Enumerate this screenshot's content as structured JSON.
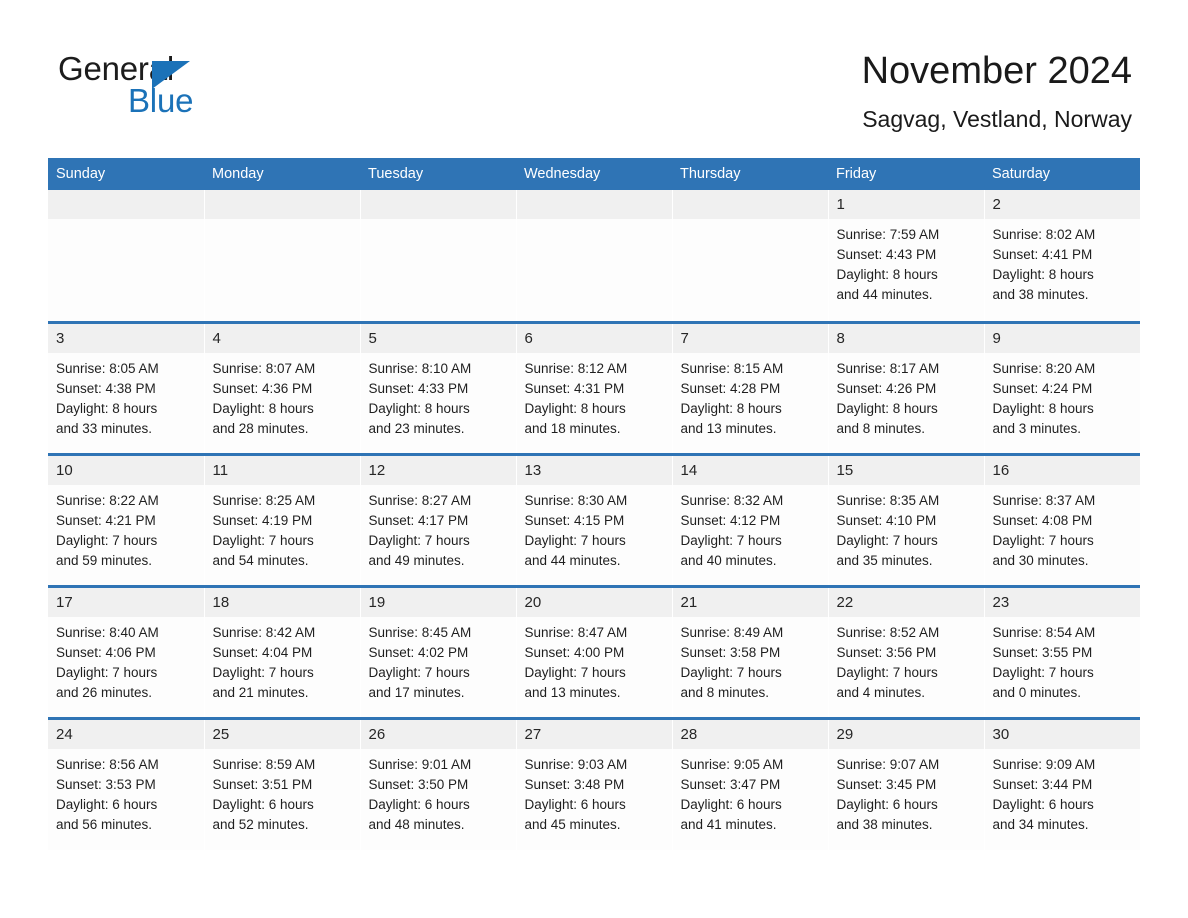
{
  "logo": {
    "word1": "General",
    "word2": "Blue",
    "triangle_color": "#1b72b8"
  },
  "header": {
    "title": "November 2024",
    "subtitle": "Sagvag, Vestland, Norway"
  },
  "theme": {
    "header_blue": "#2f74b5",
    "daynum_band": "#f0f0f0",
    "cell_background": "#fdfdfd",
    "text": "#1a1a1a"
  },
  "weekday_headers": [
    "Sunday",
    "Monday",
    "Tuesday",
    "Wednesday",
    "Thursday",
    "Friday",
    "Saturday"
  ],
  "labels": {
    "sunrise_prefix": "Sunrise:",
    "sunset_prefix": "Sunset:",
    "daylight_prefix": "Daylight:"
  },
  "weeks": [
    [
      {
        "day": "",
        "empty": true,
        "line1": "",
        "line2": "",
        "line3": "",
        "line4": ""
      },
      {
        "day": "",
        "empty": true,
        "line1": "",
        "line2": "",
        "line3": "",
        "line4": ""
      },
      {
        "day": "",
        "empty": true,
        "line1": "",
        "line2": "",
        "line3": "",
        "line4": ""
      },
      {
        "day": "",
        "empty": true,
        "line1": "",
        "line2": "",
        "line3": "",
        "line4": ""
      },
      {
        "day": "",
        "empty": true,
        "line1": "",
        "line2": "",
        "line3": "",
        "line4": ""
      },
      {
        "day": "1",
        "empty": false,
        "line1": "Sunrise: 7:59 AM",
        "line2": "Sunset: 4:43 PM",
        "line3": "Daylight: 8 hours",
        "line4": "and 44 minutes."
      },
      {
        "day": "2",
        "empty": false,
        "line1": "Sunrise: 8:02 AM",
        "line2": "Sunset: 4:41 PM",
        "line3": "Daylight: 8 hours",
        "line4": "and 38 minutes."
      }
    ],
    [
      {
        "day": "3",
        "empty": false,
        "line1": "Sunrise: 8:05 AM",
        "line2": "Sunset: 4:38 PM",
        "line3": "Daylight: 8 hours",
        "line4": "and 33 minutes."
      },
      {
        "day": "4",
        "empty": false,
        "line1": "Sunrise: 8:07 AM",
        "line2": "Sunset: 4:36 PM",
        "line3": "Daylight: 8 hours",
        "line4": "and 28 minutes."
      },
      {
        "day": "5",
        "empty": false,
        "line1": "Sunrise: 8:10 AM",
        "line2": "Sunset: 4:33 PM",
        "line3": "Daylight: 8 hours",
        "line4": "and 23 minutes."
      },
      {
        "day": "6",
        "empty": false,
        "line1": "Sunrise: 8:12 AM",
        "line2": "Sunset: 4:31 PM",
        "line3": "Daylight: 8 hours",
        "line4": "and 18 minutes."
      },
      {
        "day": "7",
        "empty": false,
        "line1": "Sunrise: 8:15 AM",
        "line2": "Sunset: 4:28 PM",
        "line3": "Daylight: 8 hours",
        "line4": "and 13 minutes."
      },
      {
        "day": "8",
        "empty": false,
        "line1": "Sunrise: 8:17 AM",
        "line2": "Sunset: 4:26 PM",
        "line3": "Daylight: 8 hours",
        "line4": "and 8 minutes."
      },
      {
        "day": "9",
        "empty": false,
        "line1": "Sunrise: 8:20 AM",
        "line2": "Sunset: 4:24 PM",
        "line3": "Daylight: 8 hours",
        "line4": "and 3 minutes."
      }
    ],
    [
      {
        "day": "10",
        "empty": false,
        "line1": "Sunrise: 8:22 AM",
        "line2": "Sunset: 4:21 PM",
        "line3": "Daylight: 7 hours",
        "line4": "and 59 minutes."
      },
      {
        "day": "11",
        "empty": false,
        "line1": "Sunrise: 8:25 AM",
        "line2": "Sunset: 4:19 PM",
        "line3": "Daylight: 7 hours",
        "line4": "and 54 minutes."
      },
      {
        "day": "12",
        "empty": false,
        "line1": "Sunrise: 8:27 AM",
        "line2": "Sunset: 4:17 PM",
        "line3": "Daylight: 7 hours",
        "line4": "and 49 minutes."
      },
      {
        "day": "13",
        "empty": false,
        "line1": "Sunrise: 8:30 AM",
        "line2": "Sunset: 4:15 PM",
        "line3": "Daylight: 7 hours",
        "line4": "and 44 minutes."
      },
      {
        "day": "14",
        "empty": false,
        "line1": "Sunrise: 8:32 AM",
        "line2": "Sunset: 4:12 PM",
        "line3": "Daylight: 7 hours",
        "line4": "and 40 minutes."
      },
      {
        "day": "15",
        "empty": false,
        "line1": "Sunrise: 8:35 AM",
        "line2": "Sunset: 4:10 PM",
        "line3": "Daylight: 7 hours",
        "line4": "and 35 minutes."
      },
      {
        "day": "16",
        "empty": false,
        "line1": "Sunrise: 8:37 AM",
        "line2": "Sunset: 4:08 PM",
        "line3": "Daylight: 7 hours",
        "line4": "and 30 minutes."
      }
    ],
    [
      {
        "day": "17",
        "empty": false,
        "line1": "Sunrise: 8:40 AM",
        "line2": "Sunset: 4:06 PM",
        "line3": "Daylight: 7 hours",
        "line4": "and 26 minutes."
      },
      {
        "day": "18",
        "empty": false,
        "line1": "Sunrise: 8:42 AM",
        "line2": "Sunset: 4:04 PM",
        "line3": "Daylight: 7 hours",
        "line4": "and 21 minutes."
      },
      {
        "day": "19",
        "empty": false,
        "line1": "Sunrise: 8:45 AM",
        "line2": "Sunset: 4:02 PM",
        "line3": "Daylight: 7 hours",
        "line4": "and 17 minutes."
      },
      {
        "day": "20",
        "empty": false,
        "line1": "Sunrise: 8:47 AM",
        "line2": "Sunset: 4:00 PM",
        "line3": "Daylight: 7 hours",
        "line4": "and 13 minutes."
      },
      {
        "day": "21",
        "empty": false,
        "line1": "Sunrise: 8:49 AM",
        "line2": "Sunset: 3:58 PM",
        "line3": "Daylight: 7 hours",
        "line4": "and 8 minutes."
      },
      {
        "day": "22",
        "empty": false,
        "line1": "Sunrise: 8:52 AM",
        "line2": "Sunset: 3:56 PM",
        "line3": "Daylight: 7 hours",
        "line4": "and 4 minutes."
      },
      {
        "day": "23",
        "empty": false,
        "line1": "Sunrise: 8:54 AM",
        "line2": "Sunset: 3:55 PM",
        "line3": "Daylight: 7 hours",
        "line4": "and 0 minutes."
      }
    ],
    [
      {
        "day": "24",
        "empty": false,
        "line1": "Sunrise: 8:56 AM",
        "line2": "Sunset: 3:53 PM",
        "line3": "Daylight: 6 hours",
        "line4": "and 56 minutes."
      },
      {
        "day": "25",
        "empty": false,
        "line1": "Sunrise: 8:59 AM",
        "line2": "Sunset: 3:51 PM",
        "line3": "Daylight: 6 hours",
        "line4": "and 52 minutes."
      },
      {
        "day": "26",
        "empty": false,
        "line1": "Sunrise: 9:01 AM",
        "line2": "Sunset: 3:50 PM",
        "line3": "Daylight: 6 hours",
        "line4": "and 48 minutes."
      },
      {
        "day": "27",
        "empty": false,
        "line1": "Sunrise: 9:03 AM",
        "line2": "Sunset: 3:48 PM",
        "line3": "Daylight: 6 hours",
        "line4": "and 45 minutes."
      },
      {
        "day": "28",
        "empty": false,
        "line1": "Sunrise: 9:05 AM",
        "line2": "Sunset: 3:47 PM",
        "line3": "Daylight: 6 hours",
        "line4": "and 41 minutes."
      },
      {
        "day": "29",
        "empty": false,
        "line1": "Sunrise: 9:07 AM",
        "line2": "Sunset: 3:45 PM",
        "line3": "Daylight: 6 hours",
        "line4": "and 38 minutes."
      },
      {
        "day": "30",
        "empty": false,
        "line1": "Sunrise: 9:09 AM",
        "line2": "Sunset: 3:44 PM",
        "line3": "Daylight: 6 hours",
        "line4": "and 34 minutes."
      }
    ]
  ]
}
